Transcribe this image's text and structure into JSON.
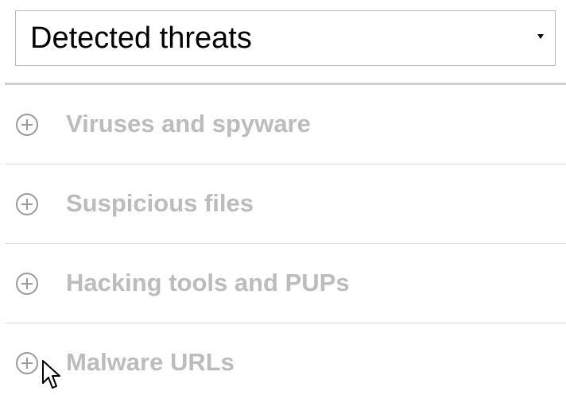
{
  "dropdown": {
    "selected": "Detected threats",
    "arrow_icon": "caret-down-icon"
  },
  "threats": {
    "items": [
      {
        "label": "Viruses and spyware",
        "icon": "plus-circle-icon"
      },
      {
        "label": "Suspicious files",
        "icon": "plus-circle-icon"
      },
      {
        "label": "Hacking tools and PUPs",
        "icon": "plus-circle-icon"
      },
      {
        "label": "Malware URLs",
        "icon": "plus-circle-icon"
      }
    ]
  },
  "colors": {
    "label_disabled": "#bcbcbc",
    "icon_stroke": "#9a9a9a",
    "divider": "#cfcfcf",
    "select_border": "#b9b9b9"
  },
  "cursor": {
    "icon": "mouse-pointer-icon"
  }
}
